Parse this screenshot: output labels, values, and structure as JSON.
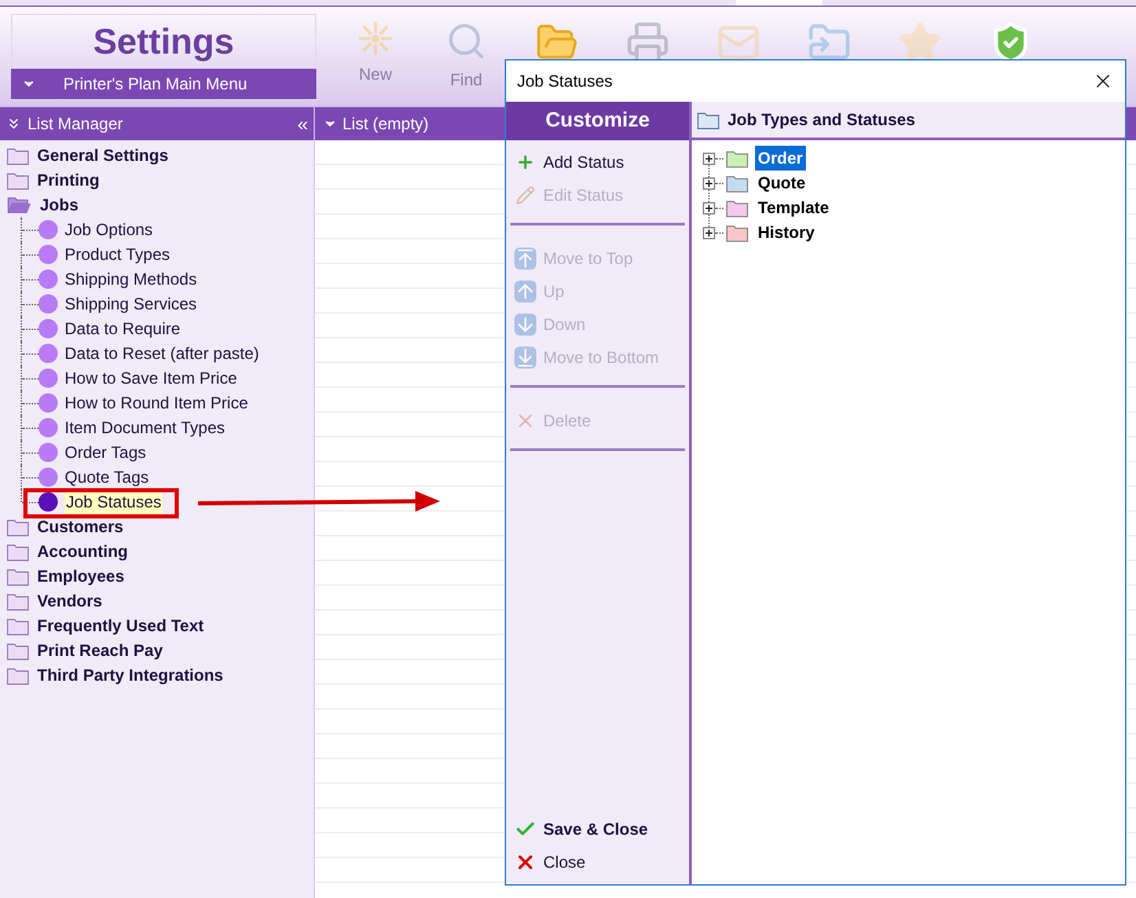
{
  "app": {
    "title": "Settings",
    "main_menu": "Printer's Plan Main Menu"
  },
  "toolbar": [
    {
      "kind": "new",
      "label": "New",
      "disabled": true
    },
    {
      "kind": "find",
      "label": "Find",
      "disabled": true
    },
    {
      "kind": "open",
      "disabled": false
    },
    {
      "kind": "print",
      "disabled": true
    },
    {
      "kind": "mail",
      "disabled": true
    },
    {
      "kind": "share",
      "disabled": true
    },
    {
      "kind": "star",
      "disabled": true
    },
    {
      "kind": "shield",
      "disabled": false
    }
  ],
  "list_manager": {
    "title": "List Manager",
    "collapse": "«",
    "items": [
      {
        "label": "General Settings",
        "expanded": false
      },
      {
        "label": "Printing",
        "expanded": false
      },
      {
        "label": "Jobs",
        "expanded": true,
        "children": [
          {
            "label": "Job Options",
            "selected": false
          },
          {
            "label": "Product Types",
            "selected": false
          },
          {
            "label": "Shipping Methods",
            "selected": false
          },
          {
            "label": "Shipping Services",
            "selected": false
          },
          {
            "label": "Data to Require",
            "selected": false
          },
          {
            "label": "Data to Reset (after paste)",
            "selected": false
          },
          {
            "label": "How to Save Item Price",
            "selected": false
          },
          {
            "label": "How to Round Item Price",
            "selected": false
          },
          {
            "label": "Item Document Types",
            "selected": false
          },
          {
            "label": "Order Tags",
            "selected": false
          },
          {
            "label": "Quote Tags",
            "selected": false
          },
          {
            "label": "Job Statuses",
            "selected": true
          }
        ]
      },
      {
        "label": "Customers",
        "expanded": false
      },
      {
        "label": "Accounting",
        "expanded": false
      },
      {
        "label": "Employees",
        "expanded": false
      },
      {
        "label": "Vendors",
        "expanded": false
      },
      {
        "label": "Frequently Used Text",
        "expanded": false
      },
      {
        "label": "Print Reach Pay",
        "expanded": false
      },
      {
        "label": "Third Party Integrations",
        "expanded": false
      }
    ]
  },
  "list_panel": {
    "title": "List (empty)"
  },
  "dialog": {
    "title": "Job Statuses",
    "customize": "Customize",
    "action_groups": [
      [
        {
          "kind": "add",
          "label": "Add Status",
          "disabled": false
        },
        {
          "kind": "edit",
          "label": "Edit Status",
          "disabled": true
        }
      ],
      [
        {
          "kind": "top",
          "label": "Move to Top",
          "disabled": true
        },
        {
          "kind": "up",
          "label": "Up",
          "disabled": true
        },
        {
          "kind": "down",
          "label": "Down",
          "disabled": true
        },
        {
          "kind": "bottom",
          "label": "Move to Bottom",
          "disabled": true
        }
      ],
      [
        {
          "kind": "delete",
          "label": "Delete",
          "disabled": true
        }
      ]
    ],
    "footer_actions": [
      {
        "kind": "save",
        "label": "Save & Close"
      },
      {
        "kind": "close",
        "label": "Close"
      }
    ],
    "tree_title": "Job Types and Statuses",
    "tree": [
      {
        "label": "Order",
        "color": "#c9f0b4",
        "selected": true
      },
      {
        "label": "Quote",
        "color": "#c4dbf2",
        "selected": false
      },
      {
        "label": "Template",
        "color": "#f3c9ee",
        "selected": false
      },
      {
        "label": "History",
        "color": "#f7c7c7",
        "selected": false
      }
    ]
  }
}
